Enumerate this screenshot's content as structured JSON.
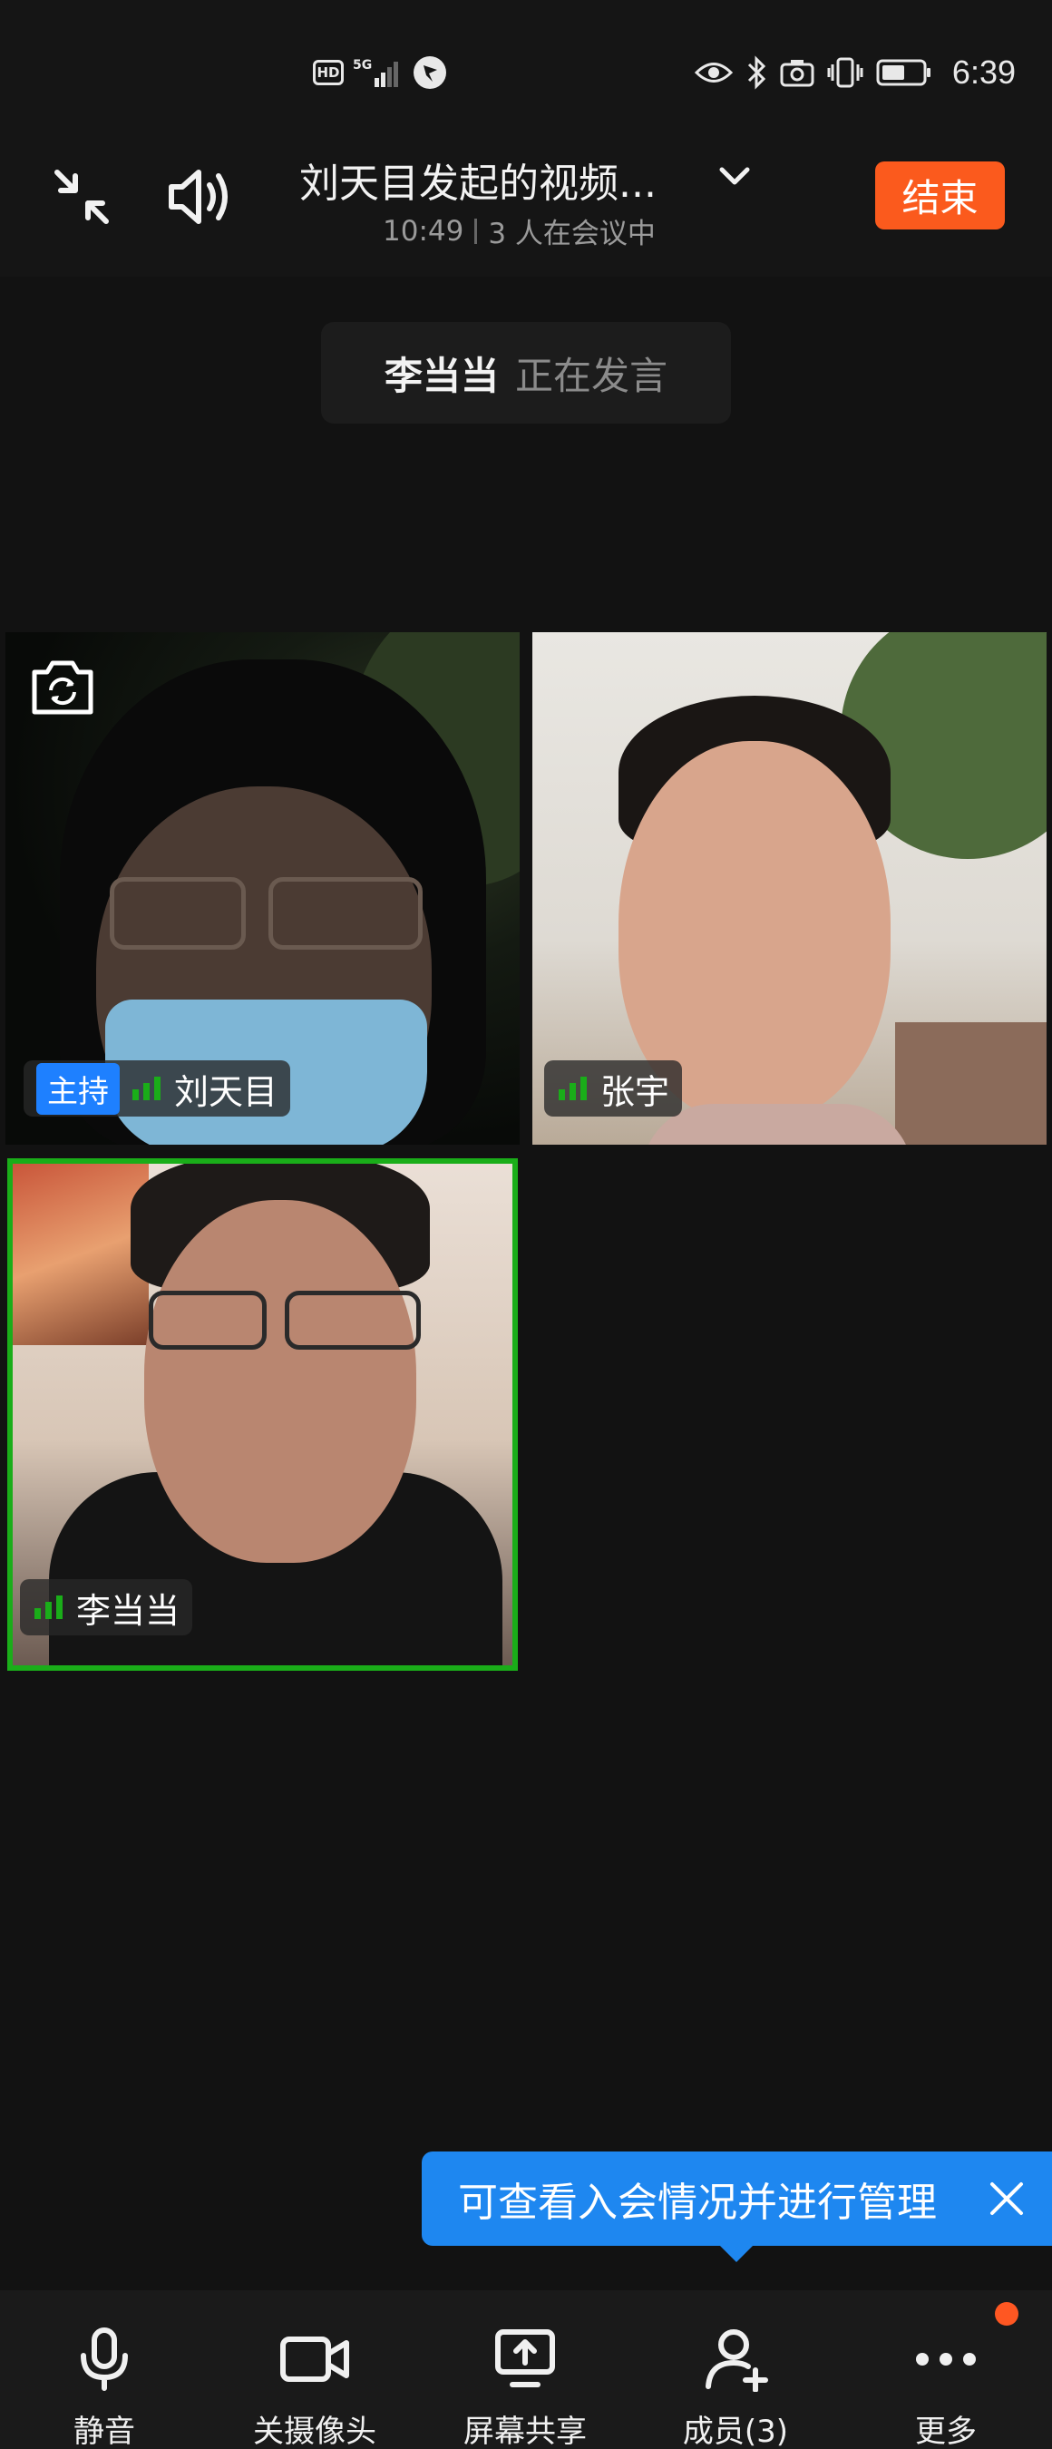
{
  "status_bar": {
    "hd": "HD",
    "network": "5G",
    "time": "6:39"
  },
  "header": {
    "title": "刘天目发起的视频...",
    "duration": "10:49",
    "participants_text": "3 人在会议中",
    "end_label": "结束"
  },
  "speaking": {
    "name": "李当当",
    "status": "正在发言"
  },
  "tiles": [
    {
      "role": "主持",
      "name": "刘天目"
    },
    {
      "name": "张宇"
    },
    {
      "name": "李当当"
    }
  ],
  "tooltip": {
    "text": "可查看入会情况并进行管理"
  },
  "toolbar": {
    "mute": "静音",
    "camera_off": "关摄像头",
    "screen_share": "屏幕共享",
    "members": "成员(3)",
    "more": "更多"
  },
  "colors": {
    "end_button": "#fb5a1d",
    "host_badge": "#1e80ff",
    "active_speaker_border": "#1aad19",
    "tooltip": "#1e87f0",
    "signal_green": "#1aad19"
  }
}
